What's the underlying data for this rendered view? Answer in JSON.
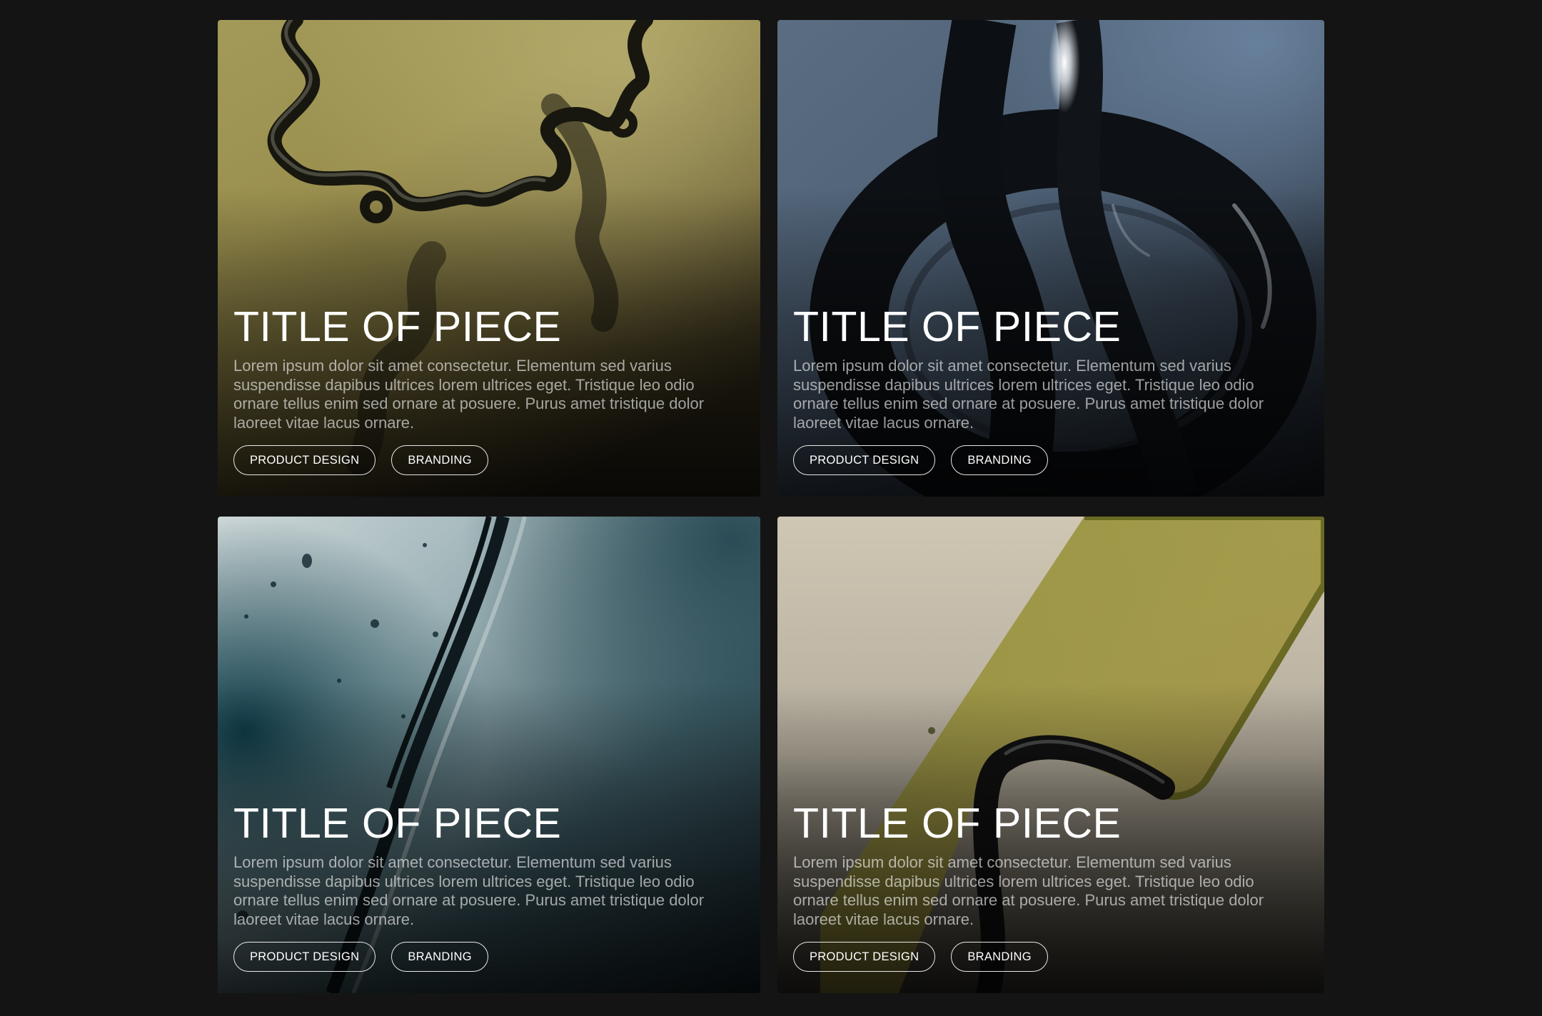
{
  "cards": [
    {
      "title": "TITLE OF PIECE",
      "description": "Lorem ipsum dolor sit amet consectetur. Elementum sed varius suspendisse dapibus ultrices lorem ultrices eget. Tristique leo odio ornare tellus enim sed ornare at posuere. Purus amet tristique dolor laoreet vitae lacus ornare.",
      "tags": [
        "PRODUCT DESIGN",
        "BRANDING"
      ]
    },
    {
      "title": "TITLE OF PIECE",
      "description": "Lorem ipsum dolor sit amet consectetur. Elementum sed varius suspendisse dapibus ultrices lorem ultrices eget. Tristique leo odio ornare tellus enim sed ornare at posuere. Purus amet tristique dolor laoreet vitae lacus ornare.",
      "tags": [
        "PRODUCT DESIGN",
        "BRANDING"
      ]
    },
    {
      "title": "TITLE OF PIECE",
      "description": "Lorem ipsum dolor sit amet consectetur. Elementum sed varius suspendisse dapibus ultrices lorem ultrices eget. Tristique leo odio ornare tellus enim sed ornare at posuere. Purus amet tristique dolor laoreet vitae lacus ornare.",
      "tags": [
        "PRODUCT DESIGN",
        "BRANDING"
      ]
    },
    {
      "title": "TITLE OF PIECE",
      "description": "Lorem ipsum dolor sit amet consectetur. Elementum sed varius suspendisse dapibus ultrices lorem ultrices eget. Tristique leo odio ornare tellus enim sed ornare at posuere. Purus amet tristique dolor laoreet vitae lacus ornare.",
      "tags": [
        "PRODUCT DESIGN",
        "BRANDING"
      ]
    }
  ],
  "colors": {
    "page_background": "#141414",
    "title_text": "#ffffff",
    "description_text": "#a3a3a3",
    "tag_border": "#ffffff"
  }
}
